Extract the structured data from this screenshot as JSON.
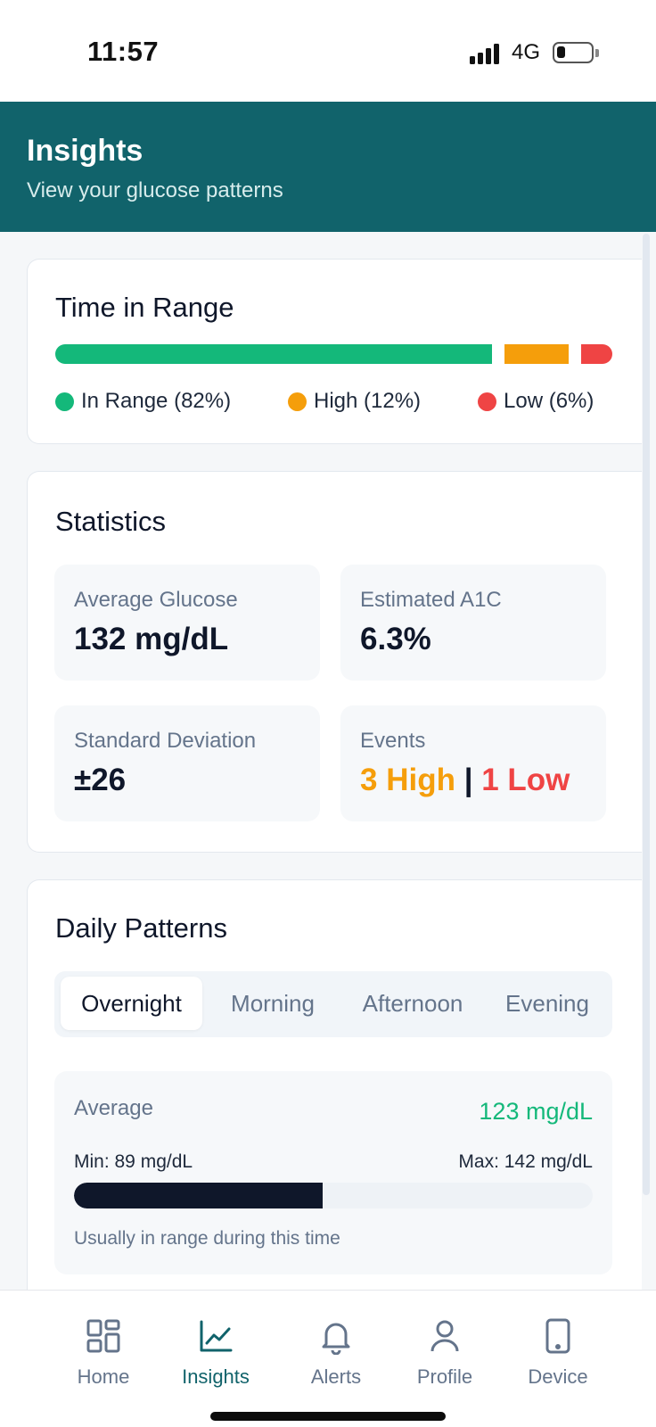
{
  "status_bar": {
    "time": "11:57",
    "network": "4G"
  },
  "header": {
    "title": "Insights",
    "subtitle": "View your glucose patterns"
  },
  "time_in_range": {
    "title": "Time in Range",
    "segments": [
      {
        "key": "in_range",
        "percent": 82,
        "color": "#14b87a"
      },
      {
        "key": "high",
        "percent": 12,
        "color": "#f59e0b"
      },
      {
        "key": "low",
        "percent": 6,
        "color": "#ef4444"
      }
    ],
    "legend": [
      {
        "label": "In Range (82%)",
        "color": "#14b87a"
      },
      {
        "label": "High (12%)",
        "color": "#f59e0b"
      },
      {
        "label": "Low (6%)",
        "color": "#ef4444"
      }
    ]
  },
  "statistics": {
    "title": "Statistics",
    "average_glucose": {
      "label": "Average Glucose",
      "value": "132 mg/dL"
    },
    "estimated_a1c": {
      "label": "Estimated A1C",
      "value": "6.3%"
    },
    "std_dev": {
      "label": "Standard Deviation",
      "value": "±26"
    },
    "events": {
      "label": "Events",
      "high": "3 High",
      "separator": "|",
      "low": "1 Low"
    }
  },
  "daily_patterns": {
    "title": "Daily Patterns",
    "tabs": [
      "Overnight",
      "Morning",
      "Afternoon",
      "Evening"
    ],
    "active_tab": "Overnight",
    "card": {
      "label": "Average",
      "average": "123 mg/dL",
      "min": "Min: 89 mg/dL",
      "max": "Max: 142 mg/dL",
      "bar_fraction": 0.48,
      "note": "Usually in range during this time"
    }
  },
  "bottom_nav": {
    "items": [
      {
        "label": "Home",
        "icon": "home-grid-icon"
      },
      {
        "label": "Insights",
        "icon": "chart-line-icon"
      },
      {
        "label": "Alerts",
        "icon": "bell-icon"
      },
      {
        "label": "Profile",
        "icon": "user-icon"
      },
      {
        "label": "Device",
        "icon": "phone-device-icon"
      }
    ],
    "active": "Insights"
  },
  "colors": {
    "brand": "#11636b",
    "in_range": "#14b87a",
    "high": "#f59e0b",
    "low": "#ef4444"
  }
}
